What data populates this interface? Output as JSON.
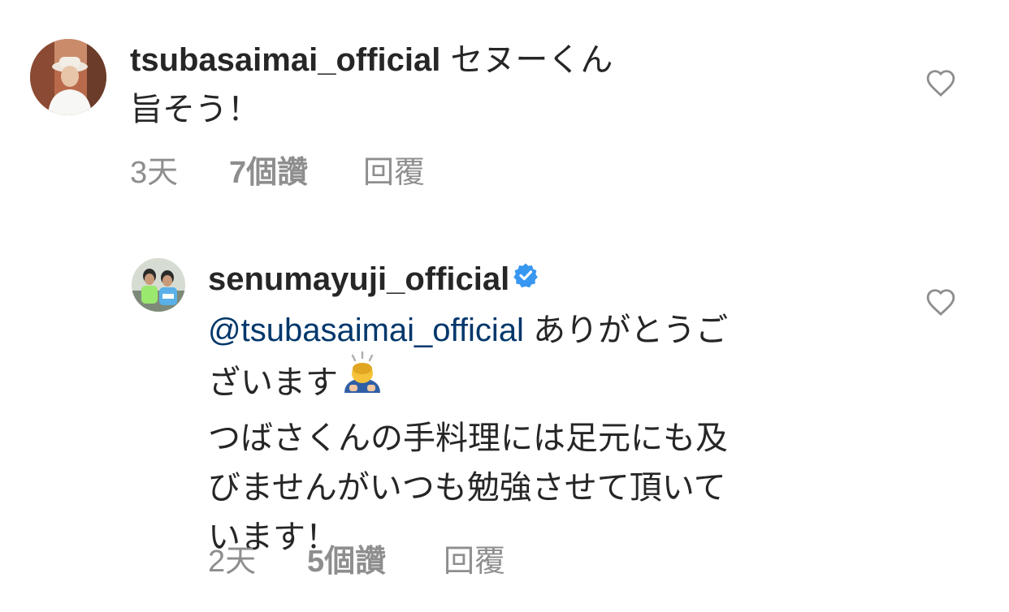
{
  "comments": [
    {
      "username": "tsubasaimai_official",
      "text_line1": "セヌーくん",
      "text_line2": "旨そう！",
      "time": "3天",
      "likes": "7個讚",
      "reply": "回覆",
      "like_icon": "heart-outline-icon"
    },
    {
      "username": "senumayuji_official",
      "verified": true,
      "mention": "@tsubasaimai_official",
      "text_after_mention": "ありがとうご",
      "line2": "ざいます",
      "emoji": "person-bowing-emoji",
      "line3": "つばさくんの手料理には足元にも及",
      "line4": "びませんがいつも勉強させて頂いて",
      "line5": "います！",
      "time": "2天",
      "likes": "5個讚",
      "reply": "回覆",
      "like_icon": "heart-outline-icon"
    }
  ],
  "colors": {
    "text": "#262626",
    "meta": "#8e8e8e",
    "mention": "#00376b",
    "verified": "#3897f0"
  }
}
